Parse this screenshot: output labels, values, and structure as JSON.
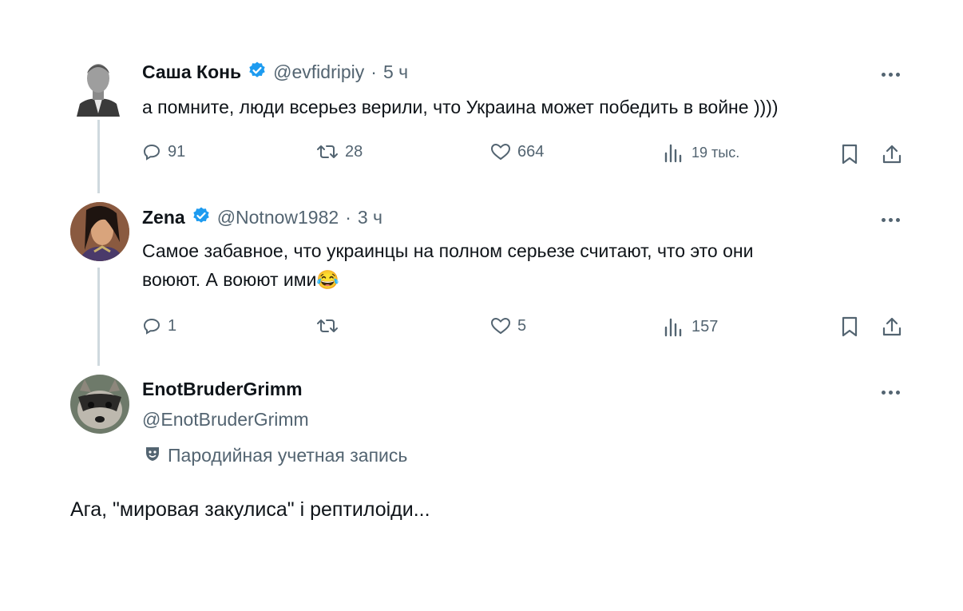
{
  "tweets": [
    {
      "name": "Саша Конь",
      "verified": true,
      "handle": "@evfidripiy",
      "time": "5 ч",
      "text": "а помните, люди всерьез верили, что Украина может победить в войне ))))",
      "replies": "91",
      "retweets": "28",
      "likes": "664",
      "views": "19 тыс."
    },
    {
      "name": "Zena",
      "verified": true,
      "handle": "@Notnow1982",
      "time": "3 ч",
      "text_line1": "Самое забавное, что украинцы на полном серьезе считают, что это они",
      "text_line2": "воюют. А воюют ими",
      "emoji": "😂",
      "replies": "1",
      "retweets": "",
      "likes": "5",
      "views": "157"
    }
  ],
  "reply_author": {
    "name": "EnotBruderGrimm",
    "handle": "@EnotBruderGrimm",
    "parody_label": "Пародийная учетная запись",
    "text": "Ага, \"мировая закулиса\" і рептилоіди..."
  },
  "icons": [
    "more-icon",
    "reply-icon",
    "retweet-icon",
    "like-icon",
    "views-icon",
    "bookmark-icon",
    "share-icon",
    "verified-icon",
    "parody-mask-icon"
  ],
  "colors": {
    "verified": "#1d9bf0",
    "muted": "#536471",
    "thread_line": "#cfd9de"
  }
}
